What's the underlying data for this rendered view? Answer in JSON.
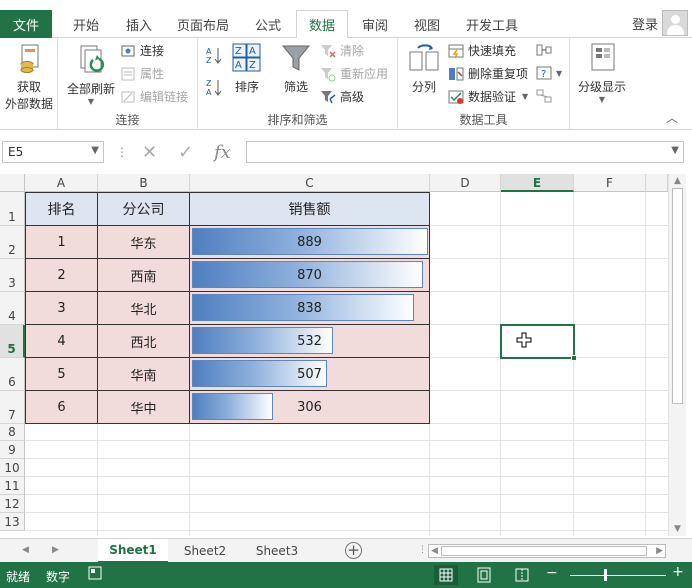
{
  "window": {
    "login_label": "登录"
  },
  "ribbon_tabs": [
    "文件",
    "开始",
    "插入",
    "页面布局",
    "公式",
    "数据",
    "审阅",
    "视图",
    "开发工具"
  ],
  "ribbon": {
    "get_external": {
      "label_line1": "获取",
      "label_line2": "外部数据"
    },
    "connections": {
      "refresh_all": "全部刷新",
      "connect": "连接",
      "properties": "属性",
      "edit_links": "编辑链接",
      "group_label": "连接"
    },
    "sort_filter": {
      "sort": "排序",
      "filter": "筛选",
      "clear": "清除",
      "reapply": "重新应用",
      "advanced": "高级",
      "group_label": "排序和筛选"
    },
    "data_tools": {
      "split": "分列",
      "flash_fill": "快速填充",
      "remove_dup": "删除重复项",
      "validation": "数据验证",
      "group_label": "数据工具"
    },
    "outline": {
      "label": "分级显示"
    }
  },
  "formula_bar": {
    "name_box": "E5",
    "fx": "fx",
    "cancel": "✕",
    "enter": "✓",
    "content": ""
  },
  "columns": [
    "A",
    "B",
    "C",
    "D",
    "E",
    "F"
  ],
  "rows": [
    "1",
    "2",
    "3",
    "4",
    "5",
    "6",
    "7",
    "8",
    "9",
    "10",
    "11",
    "12",
    "13"
  ],
  "table": {
    "headers": [
      "排名",
      "分公司",
      "销售额"
    ],
    "rows": [
      {
        "rank": "1",
        "branch": "华东",
        "sales": 889
      },
      {
        "rank": "2",
        "branch": "西南",
        "sales": 870
      },
      {
        "rank": "3",
        "branch": "华北",
        "sales": 838
      },
      {
        "rank": "4",
        "branch": "西北",
        "sales": 532
      },
      {
        "rank": "5",
        "branch": "华南",
        "sales": 507
      },
      {
        "rank": "6",
        "branch": "华中",
        "sales": 306
      }
    ],
    "databar_max": 889,
    "databar_color": "#4f7fc0",
    "header_fill": "#dde5f0",
    "body_fill": "#f2dcdb"
  },
  "selected_cell": "E5",
  "sheets": [
    "Sheet1",
    "Sheet2",
    "Sheet3"
  ],
  "active_sheet": "Sheet1",
  "status": {
    "ready": "就绪",
    "num": "数字"
  },
  "colors": {
    "accent": "#217346"
  }
}
